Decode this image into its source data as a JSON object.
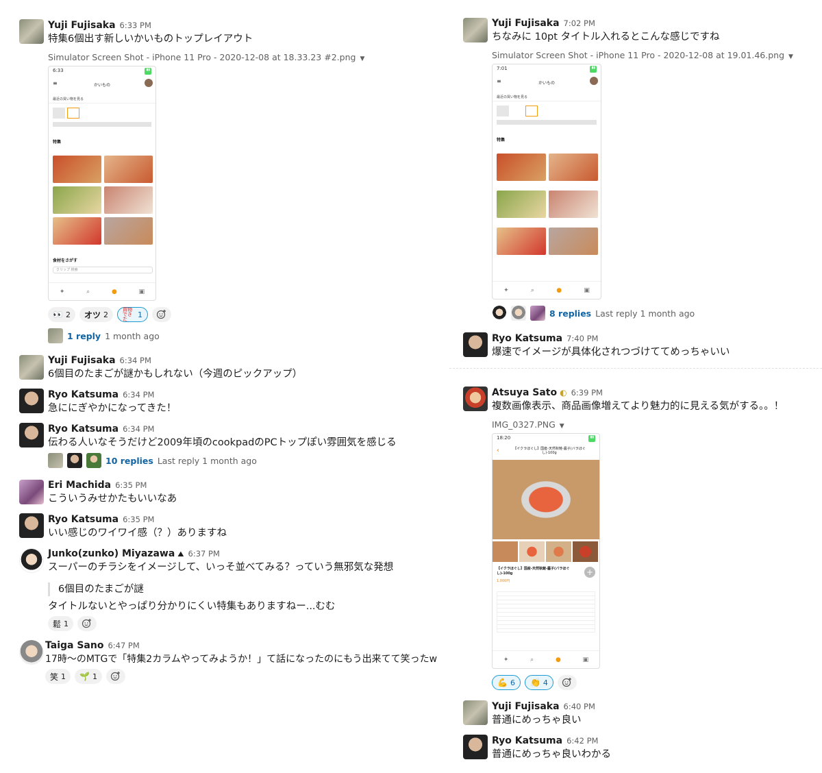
{
  "left": {
    "m1": {
      "name": "Yuji Fujisaka",
      "time": "6:33 PM",
      "text": "特集6個出す新しいかいものトップレイアウト",
      "file": "Simulator Screen Shot - iPhone 11 Pro - 2020-12-08 at 18.33.23 #2.png",
      "phone": {
        "time": "6:33",
        "title": "かいもの",
        "recent": "最近の買い物を見る",
        "feature": "特集",
        "search": "食材をさがす",
        "search_ph": "クリップ 検索"
      },
      "reactions": [
        {
          "emoji": "👀",
          "count": "2"
        },
        {
          "emoji": "オツ",
          "count": "2"
        },
        {
          "emoji": "買物できた",
          "count": "1"
        }
      ],
      "thread": {
        "count": "1 reply",
        "last": "1 month ago"
      }
    },
    "m2": {
      "name": "Yuji Fujisaka",
      "time": "6:34 PM",
      "text": "6個目のたまごが謎かもしれない（今週のピックアップ）"
    },
    "m3": {
      "name": "Ryo Katsuma",
      "time": "6:34 PM",
      "text": "急ににぎやかになってきた！"
    },
    "m4": {
      "name": "Ryo Katsuma",
      "time": "6:34 PM",
      "text": "伝わる人いなそうだけど2009年頃のcookpadのPCトップぽい雰囲気を感じる",
      "thread": {
        "count": "10 replies",
        "last": "Last reply 1 month ago"
      }
    },
    "m5": {
      "name": "Eri Machida",
      "time": "6:35 PM",
      "text": "こういうみせかたもいいなあ"
    },
    "m6": {
      "name": "Ryo Katsuma",
      "time": "6:35 PM",
      "text": "いい感じのワイワイ感（？）ありますね"
    },
    "m7": {
      "name": "Junko(zunko) Miyazawa",
      "time": "6:37 PM",
      "text": "スーパーのチラシをイメージして、いっそ並べてみる？っていう無邪気な発想",
      "quote": "6個目のたまごが謎",
      "text2": "タイトルないとやっぱり分かりにくい特集もありますねー...むむ",
      "reactions": [
        {
          "emoji": "鬆",
          "count": "1"
        }
      ]
    },
    "m8": {
      "name": "Taiga Sano",
      "time": "6:47 PM",
      "text": "17時〜のMTGで「特集2カラムやってみようか！」て話になったのにもう出来てて笑ったw",
      "reactions": [
        {
          "emoji": "笑",
          "count": "1"
        },
        {
          "emoji": "🌱",
          "count": "1"
        }
      ]
    }
  },
  "right": {
    "m1": {
      "name": "Yuji Fujisaka",
      "time": "7:02 PM",
      "text": "ちなみに 10pt タイトル入れるとこんな感じですね",
      "file": "Simulator Screen Shot - iPhone 11 Pro - 2020-12-08 at 19.01.46.png",
      "phone": {
        "time": "7:01",
        "title": "かいもの",
        "recent": "最近の買い物を見る",
        "feature": "特集"
      },
      "thread": {
        "count": "8 replies",
        "last": "Last reply 1 month ago"
      }
    },
    "m2": {
      "name": "Ryo Katsuma",
      "time": "7:40 PM",
      "text": "爆速でイメージが具体化されつづけててめっちゃいい"
    },
    "m3": {
      "name": "Atsuya Sato",
      "time": "6:39 PM",
      "text": "複数画像表示、商品画像増えてより魅力的に見える気がする。。！",
      "file": "IMG_0327.PNG",
      "phone": {
        "time": "18:20",
        "product": "【イクラほぐし】国産-天然秋鮭-醤子(バラほぐし)-100g",
        "price": "1,000円"
      },
      "reactions": [
        {
          "emoji": "💪",
          "count": "6"
        },
        {
          "emoji": "👏",
          "count": "4"
        }
      ]
    },
    "m4": {
      "name": "Yuji Fujisaka",
      "time": "6:40 PM",
      "text": "普通にめっちゃ良い"
    },
    "m5": {
      "name": "Ryo Katsuma",
      "time": "6:42 PM",
      "text": "普通にめっちゃ良いわかる"
    }
  },
  "icons": {
    "dropdown": "caret-down-icon",
    "add_reaction": "add-reaction-icon"
  },
  "colors": {
    "link": "#1264a3",
    "muted": "#616061",
    "reaction_selected_border": "#1d9bd1"
  }
}
